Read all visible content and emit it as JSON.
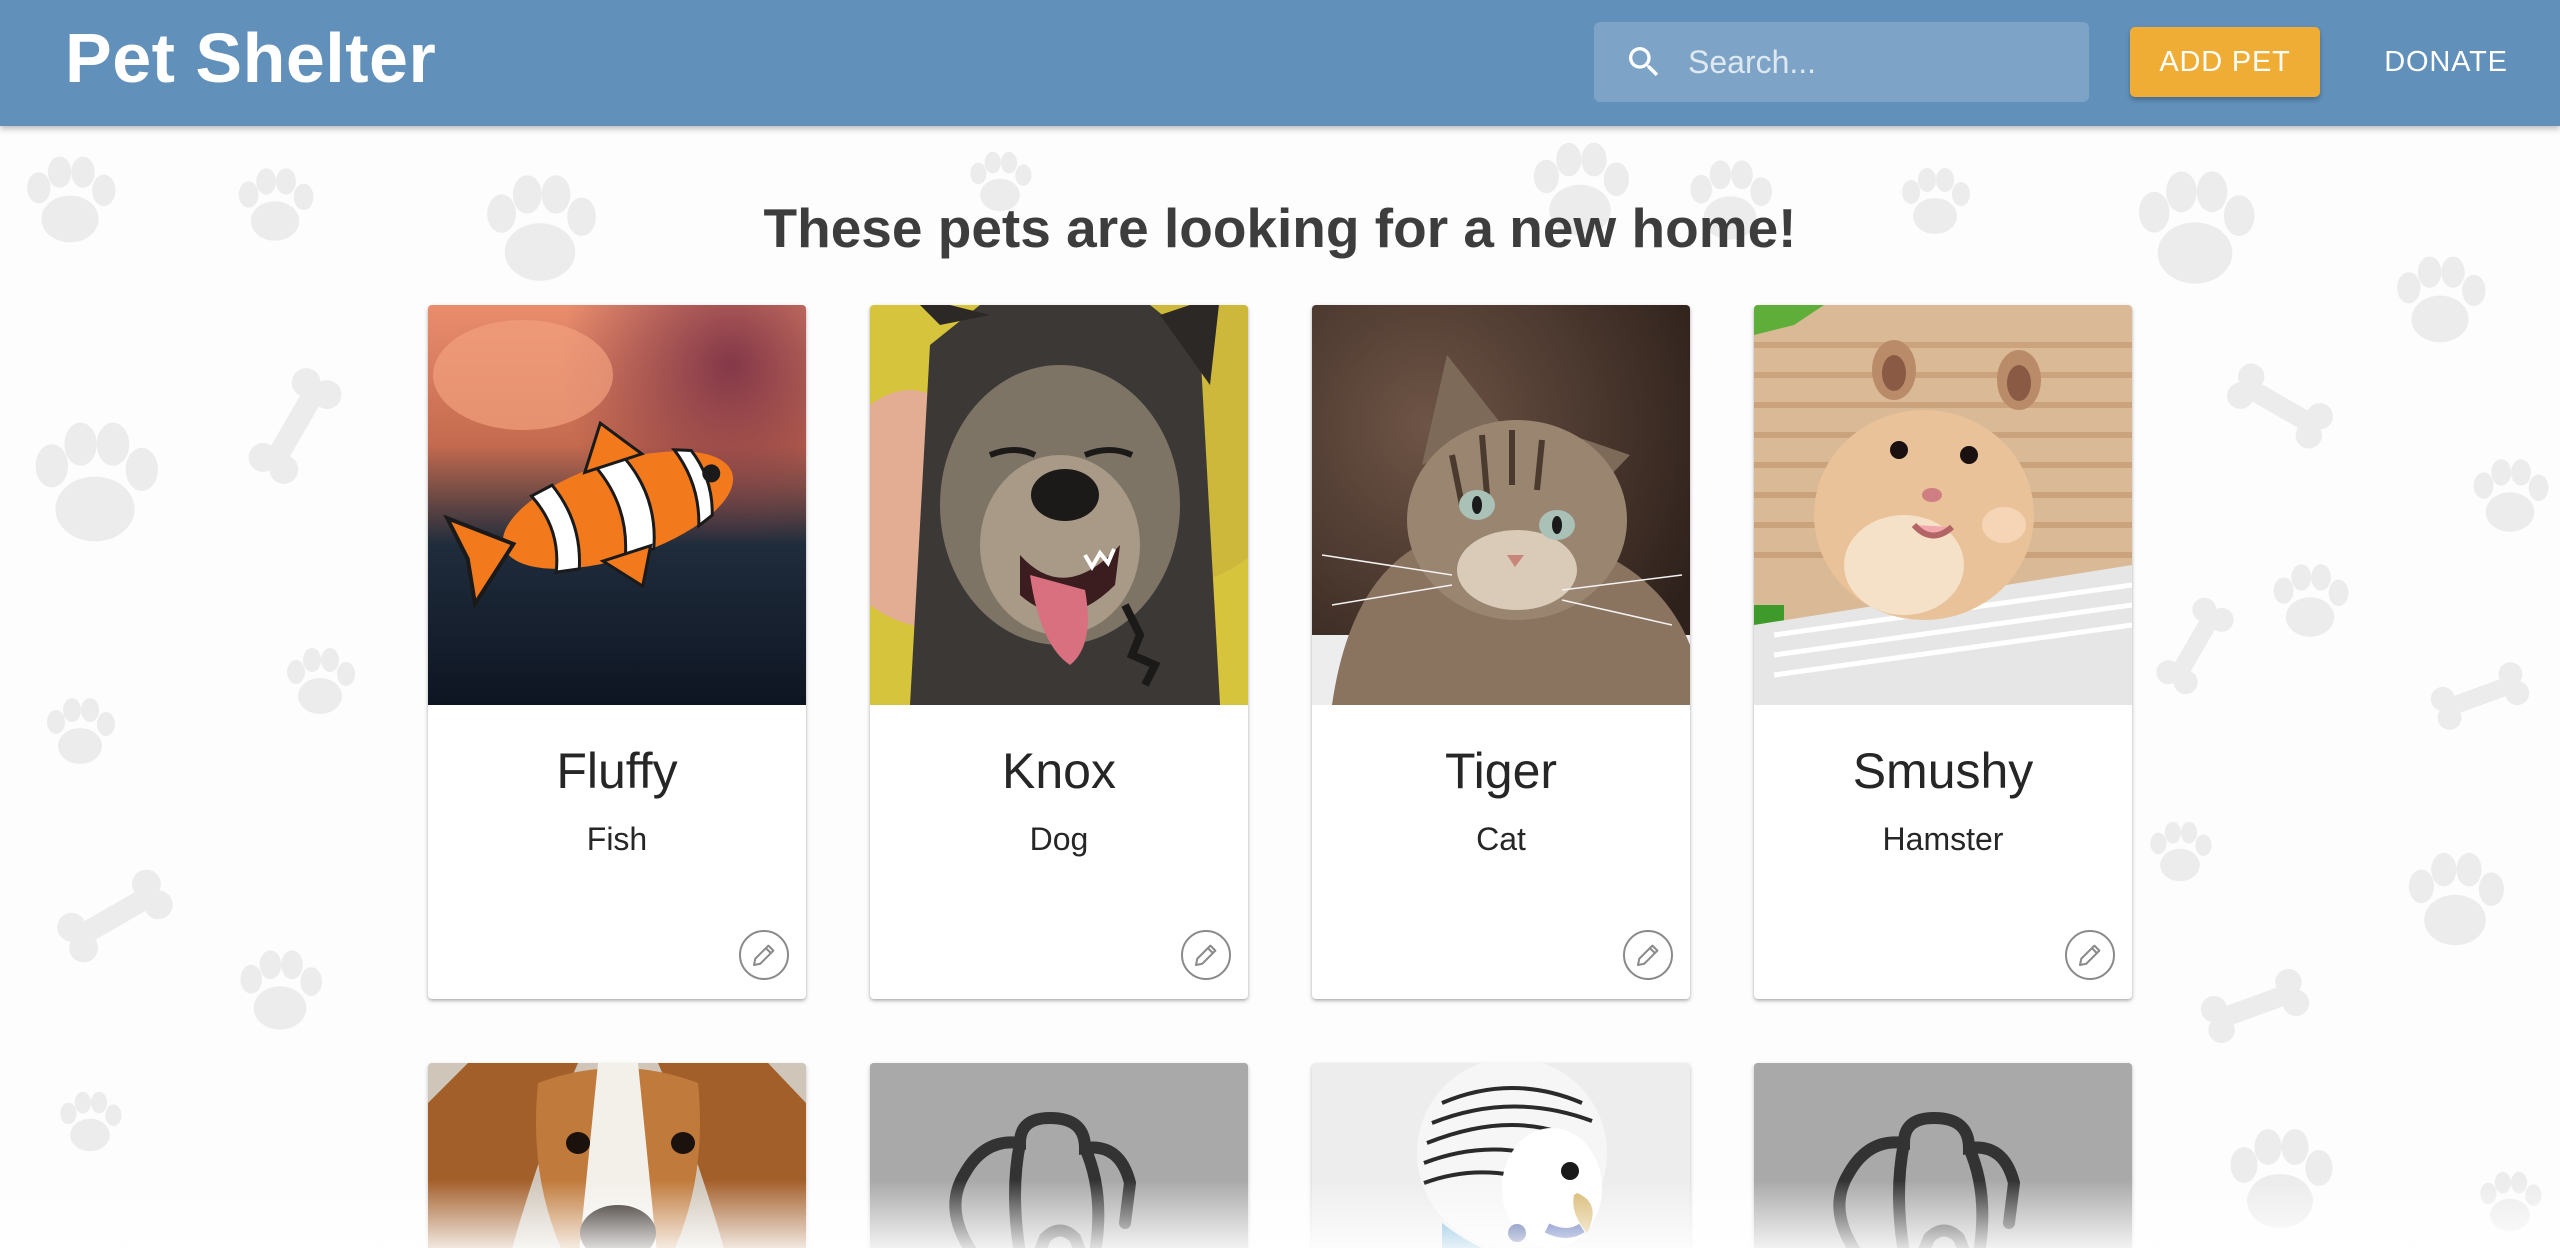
{
  "header": {
    "title": "Pet Shelter",
    "search_placeholder": "Search...",
    "add_pet_label": "ADD PET",
    "donate_label": "DONATE"
  },
  "main": {
    "heading": "These pets are looking for a new home!"
  },
  "pets": [
    {
      "name": "Fluffy",
      "type": "Fish"
    },
    {
      "name": "Knox",
      "type": "Dog"
    },
    {
      "name": "Tiger",
      "type": "Cat"
    },
    {
      "name": "Smushy",
      "type": "Hamster"
    }
  ],
  "colors": {
    "appbar": "#6190bb",
    "accent": "#f0ad35",
    "placeholder_tile": "#a9a9a9"
  },
  "icons": [
    "search-icon",
    "pencil-icon",
    "paw-icon",
    "bone-icon",
    "dog-placeholder-icon"
  ]
}
